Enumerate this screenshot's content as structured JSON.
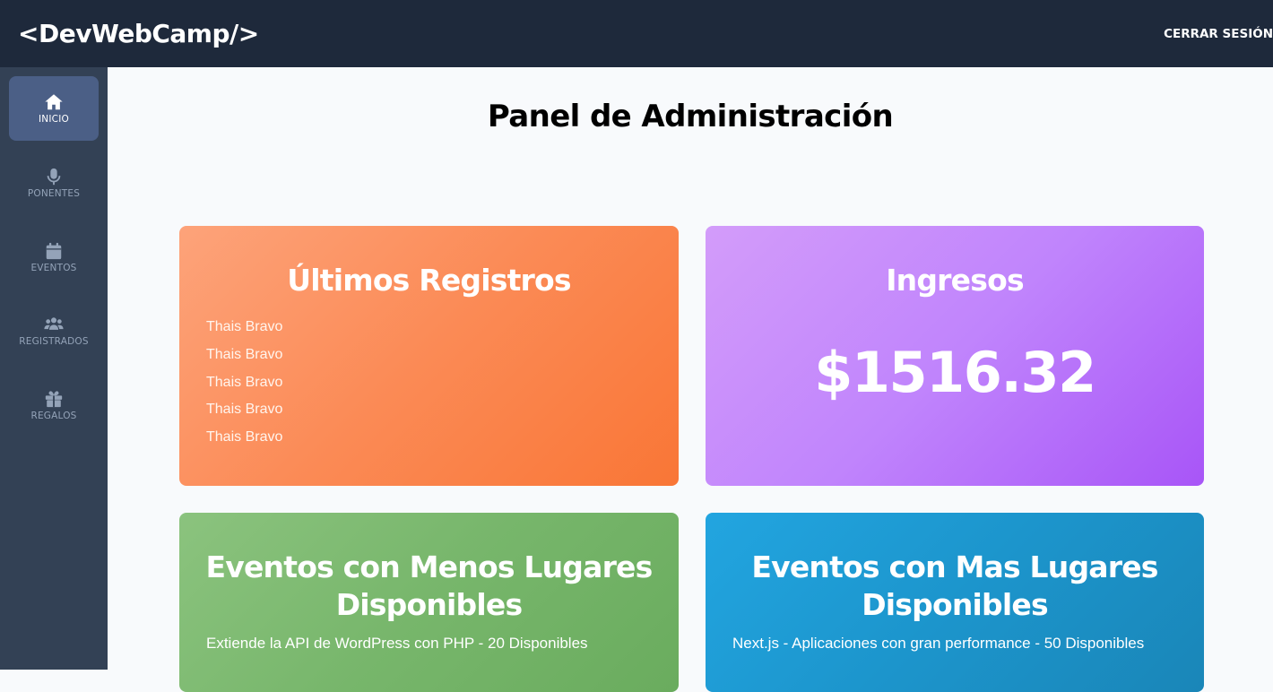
{
  "header": {
    "logo": "<DevWebCamp/>",
    "logout_label": "CERRAR SESIÓN"
  },
  "sidebar": {
    "items": [
      {
        "label": "INICIO",
        "icon": "home-icon",
        "active": true
      },
      {
        "label": "PONENTES",
        "icon": "microphone-icon",
        "active": false
      },
      {
        "label": "EVENTOS",
        "icon": "calendar-icon",
        "active": false
      },
      {
        "label": "REGISTRADOS",
        "icon": "users-icon",
        "active": false
      },
      {
        "label": "REGALOS",
        "icon": "gift-icon",
        "active": false
      }
    ]
  },
  "main": {
    "title": "Panel de Administración",
    "registros": {
      "title": "Últimos Registros",
      "items": [
        "Thais Bravo",
        "Thais Bravo",
        "Thais Bravo",
        "Thais Bravo",
        "Thais Bravo"
      ]
    },
    "ingresos": {
      "title": "Ingresos",
      "amount": "$1516.32"
    },
    "menos_lugares": {
      "title": "Eventos con Menos Lugares Disponibles",
      "items": [
        "Extiende la API de WordPress con PHP - 20 Disponibles"
      ]
    },
    "mas_lugares": {
      "title": "Eventos con Mas Lugares Disponibles",
      "items": [
        "Next.js - Aplicaciones con gran performance - 50 Disponibles"
      ]
    }
  },
  "colors": {
    "header_bg": "#1e293b",
    "sidebar_bg": "#334155",
    "active_item_bg": "#4b5f86",
    "orange": "#f97636",
    "purple": "#a855f7",
    "green": "#6aac5e",
    "blue": "#1a86b8"
  }
}
